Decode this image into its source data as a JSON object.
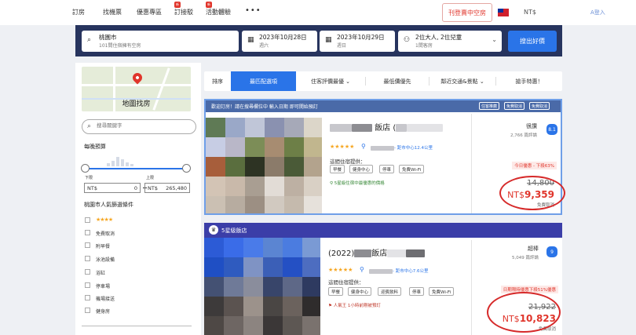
{
  "nav": {
    "items": [
      {
        "label": "訂房",
        "badge": ""
      },
      {
        "label": "找機票",
        "badge": ""
      },
      {
        "label": "優惠專區",
        "badge": ""
      },
      {
        "label": "訂接駁",
        "badge": "新"
      },
      {
        "label": "活動體驗",
        "badge": "新"
      }
    ],
    "more": "•••",
    "list_property": "刊登賣中空房",
    "currency": "NT$",
    "right_text": "A登入"
  },
  "search": {
    "destination": "桃園市",
    "destination_sub": "101間住宿擁有空房",
    "checkin": "2023年10月28日",
    "checkin_day": "週六",
    "checkout": "2023年10月29日",
    "checkout_day": "週日",
    "guests": "2位大人, 2位兒童",
    "rooms": "1間客房",
    "button": "搜出好價"
  },
  "sidebar": {
    "map_label": "地圖找房",
    "search_placeholder": "搜尋關鍵字",
    "budget_title": "每晚預算",
    "min_label": "下限",
    "max_label": "上限",
    "min_currency": "NT$",
    "min_value": "0",
    "max_currency": "NT$",
    "max_value": "265,480",
    "popular_title": "桃園市人氣篩選條件",
    "filters": [
      {
        "label": "★★★★",
        "stars": true
      },
      {
        "label": "免費取消",
        "stars": false
      },
      {
        "label": "附早餐",
        "stars": false
      },
      {
        "label": "泳池設備",
        "stars": false
      },
      {
        "label": "浴缸",
        "stars": false
      },
      {
        "label": "停車場",
        "stars": false
      },
      {
        "label": "機場接送",
        "stars": false
      },
      {
        "label": "健身房",
        "stars": false
      }
    ]
  },
  "sort": {
    "label": "排序",
    "items": [
      "最匹配選項",
      "住客評價最優",
      "最低價優先",
      "鄰近交通&景點",
      "搶手特惠！"
    ]
  },
  "hotels": [
    {
      "banner": "歡迎訂房！請在搜尋欄位中 輸入日期 即可開始預訂",
      "pills": [
        "住客推薦",
        "免費取消",
        "免費取消"
      ],
      "name_suffix": "飯店",
      "stars": "★★★★★",
      "distance": "- 距市中心12.4公里",
      "facilities_title": "這間住宿提供：",
      "facilities": [
        "早餐",
        "健身中心",
        "停車",
        "免費Wi-Fi"
      ],
      "note": "5星級住宿中最優惠的價格",
      "rating_label": "很讚",
      "rating_count": "2,766 篇評論",
      "score": "8.1",
      "deal": "今日優惠 - 下殺63%",
      "old_price": "14,800",
      "currency": "NT$",
      "price": "9,359",
      "free_cancel": "免費取消"
    },
    {
      "banner": "5星級飯店",
      "name_prefix": "(2022)",
      "name_suffix": "飯店",
      "stars": "★★★★★",
      "distance": "- 距市中心7.6公里",
      "facilities_title": "這間住宿提供：",
      "facilities": [
        "早餐",
        "健身中心",
        "迎賓飲料",
        "停車",
        "免費Wi-Fi"
      ],
      "note": "人氣王 1小時前剛被預訂",
      "rating_label": "超棒",
      "rating_count": "5,049 篇評論",
      "score": "9",
      "deal": "日期限時優惠下殺51%優惠",
      "old_price": "21,922",
      "currency": "NT$",
      "price": "10,823",
      "free_cancel": "免費取消"
    }
  ],
  "colors": {
    "primary": "#2a74e8",
    "header_dark": "#27345e",
    "price_red": "#e0352b",
    "star": "#f6a723",
    "annotation_circle": "#d62a2a"
  }
}
